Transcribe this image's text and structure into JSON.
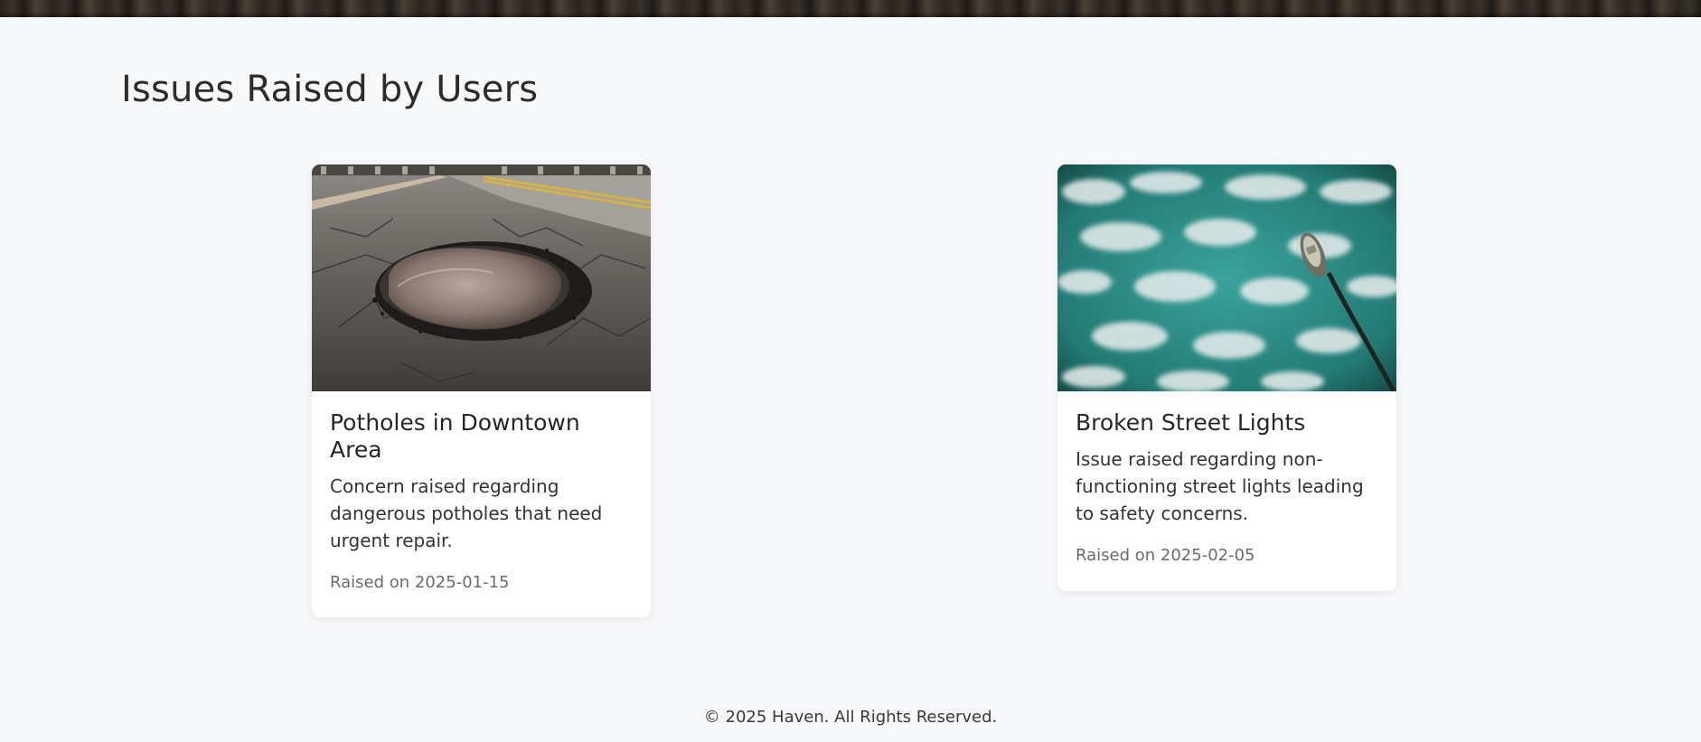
{
  "page": {
    "title": "Issues Raised by Users"
  },
  "issues": [
    {
      "image_name": "pothole-photo",
      "title": "Potholes in Downtown Area",
      "description": "Concern raised regarding dangerous potholes that need urgent repair.",
      "date_label": "Raised on 2025-01-15"
    },
    {
      "image_name": "street-light-photo",
      "title": "Broken Street Lights",
      "description": "Issue raised regarding non-functioning street lights leading to safety concerns.",
      "date_label": "Raised on 2025-02-05"
    }
  ],
  "footer": {
    "text": "© 2025 Haven. All Rights Reserved."
  },
  "colors": {
    "background": "#f7f8fa",
    "card": "#ffffff",
    "sky": "#2f8f8a"
  }
}
